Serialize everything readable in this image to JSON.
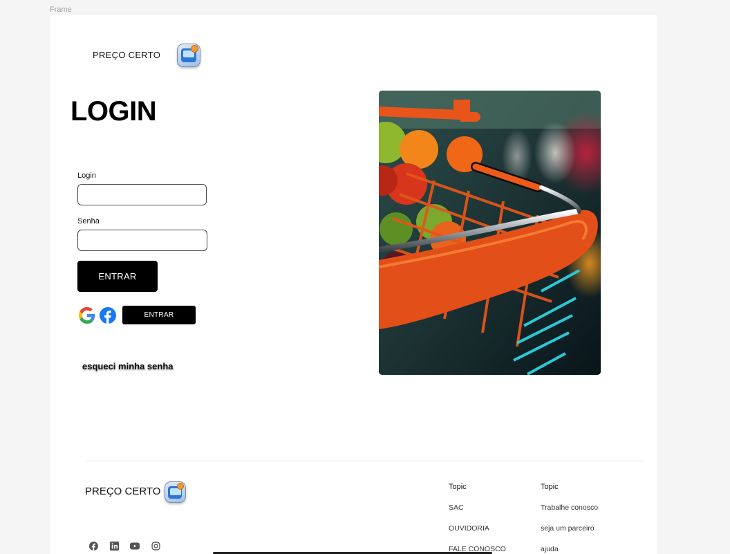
{
  "canvas": {
    "frame_label": "Frame"
  },
  "header": {
    "brand": "PREÇO CERTO",
    "logo_icon": "shopping-app-icon"
  },
  "login": {
    "title": "LOGIN",
    "login_label": "Login",
    "login_value": "",
    "password_label": "Senha",
    "password_value": "",
    "submit_label": "ENTRAR",
    "social_submit_label": "ENTRAR",
    "forgot_label": "esqueci minha senha",
    "social_icons": [
      "google-icon",
      "facebook-icon"
    ]
  },
  "hero": {
    "image": "shopping-cart-photo"
  },
  "footer": {
    "brand": "PREÇO CERTO",
    "social_icons": [
      "facebook-icon",
      "linkedin-icon",
      "youtube-icon",
      "instagram-icon"
    ],
    "columns": [
      {
        "heading": "Topic",
        "links": [
          "SAC",
          "OUVIDORIA",
          "FALE CONOSCO"
        ]
      },
      {
        "heading": "Topic",
        "links": [
          "Trabalhe conosco",
          "seja um parceiro",
          "ajuda"
        ]
      }
    ]
  },
  "colors": {
    "primary": "#000000",
    "cart_orange": "#f05a1a",
    "cart_teal": "#2cc8d6",
    "background": "#ffffff",
    "canvas": "#f5f5f5"
  }
}
